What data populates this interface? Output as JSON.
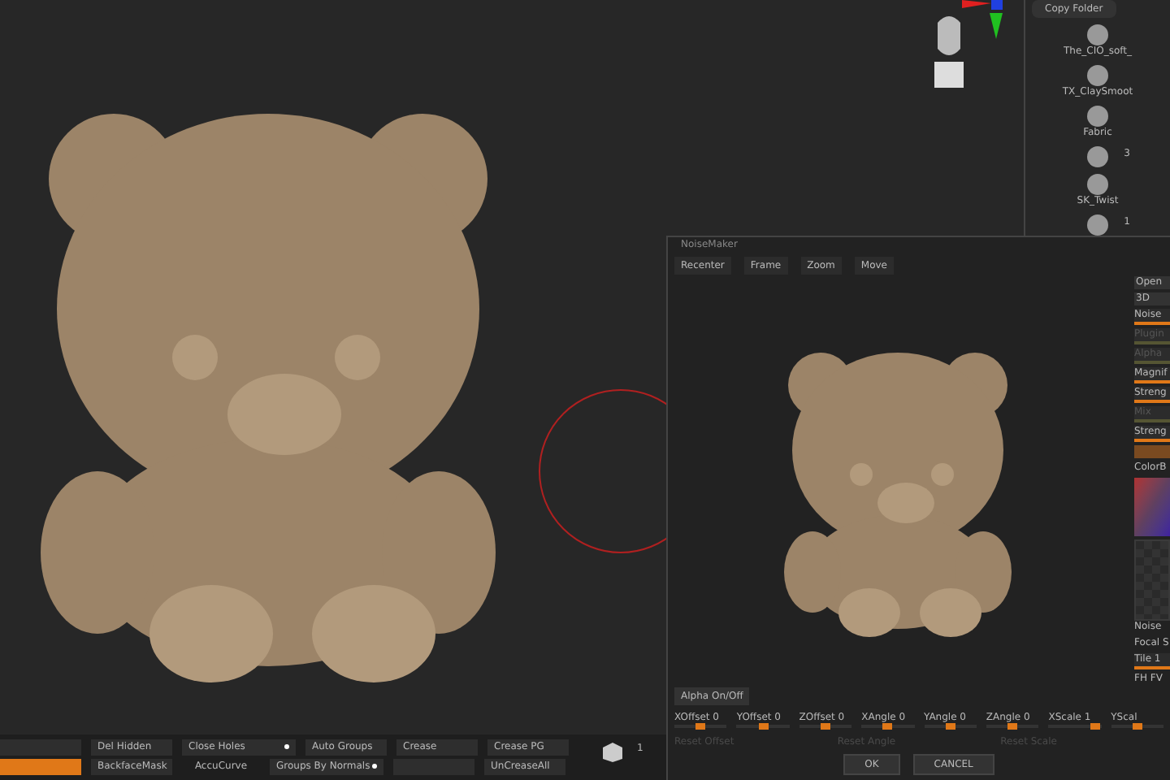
{
  "brushes": {
    "button": "Copy Folder",
    "items": [
      {
        "label": "The_CIO_soft_"
      },
      {
        "label": "TX_ClaySmoot"
      },
      {
        "label": "Fabric"
      },
      {
        "count": "3"
      },
      {
        "label": "SK_Twist"
      },
      {
        "count": "1"
      }
    ]
  },
  "toolbar": {
    "rows": [
      [
        {
          "kind": "button",
          "active": false
        },
        {
          "label": "Del Hidden",
          "kind": "button",
          "active": false
        },
        {
          "label": "Close Holes",
          "kind": "toggle",
          "active": false
        },
        {
          "label": "Auto Groups",
          "kind": "button",
          "active": false
        },
        {
          "label": "Crease",
          "kind": "button",
          "active": false
        },
        {
          "label": "Crease PG",
          "kind": "button",
          "active": false
        }
      ],
      [
        {
          "kind": "button",
          "active": true
        },
        {
          "label": "BackfaceMask",
          "kind": "button",
          "active": false
        },
        {
          "label": "AccuCurve",
          "kind": "plain",
          "active": false
        },
        {
          "label": "Groups By Normals",
          "kind": "toggle",
          "active": false
        },
        {
          "kind": "button",
          "active": false
        },
        {
          "label": "UnCreaseAll",
          "kind": "button",
          "active": false
        }
      ]
    ],
    "count": "1"
  },
  "noisemaker": {
    "title": "NoiseMaker",
    "tools": [
      "Recenter",
      "Frame",
      "Zoom",
      "Move"
    ],
    "alpha_button": "Alpha On/Off",
    "side": [
      {
        "label": "Open",
        "kind": "button",
        "dim": false
      },
      {
        "label": "3D",
        "kind": "button",
        "dim": false
      },
      {
        "label": "Noise",
        "kind": "slider",
        "dim": false
      },
      {
        "label": "Plugin",
        "kind": "slider",
        "dim": true
      },
      {
        "label": "Alpha",
        "kind": "slider",
        "dim": true
      },
      {
        "label": "Magnif",
        "kind": "slider",
        "dim": false
      },
      {
        "label": "Streng",
        "kind": "slider",
        "dim": false
      },
      {
        "label": "Mix",
        "kind": "slider",
        "dim": true
      },
      {
        "label": "Streng",
        "kind": "slider",
        "dim": false
      },
      {
        "kind": "swatch",
        "dim": false
      },
      {
        "label": "ColorB",
        "kind": "label",
        "dim": false
      },
      {
        "kind": "picker",
        "dim": false
      },
      {
        "label": "Noise",
        "kind": "checker",
        "dim": false
      },
      {
        "label": "Focal S",
        "kind": "label",
        "dim": false
      },
      {
        "label": "Tile 1",
        "kind": "slider",
        "dim": false
      },
      {
        "label": "FH FV",
        "kind": "label",
        "dim": false
      }
    ],
    "sliders": [
      {
        "label": "XOffset 0",
        "level": 0.5
      },
      {
        "label": "YOffset 0",
        "level": 0.5
      },
      {
        "label": "ZOffset 0",
        "level": 0.5
      },
      {
        "label": "XAngle 0",
        "level": 0.5
      },
      {
        "label": "YAngle 0",
        "level": 0.5
      },
      {
        "label": "ZAngle 0",
        "level": 0.5
      },
      {
        "label": "XScale 1",
        "level": 0.9
      },
      {
        "label": "YScal",
        "level": 0.5
      }
    ],
    "resets": [
      {
        "label": "Reset Offset",
        "disabled": true
      },
      {
        "label": "Reset Angle",
        "disabled": true
      },
      {
        "label": "Reset Scale",
        "disabled": true
      }
    ],
    "buttons": [
      "OK",
      "CANCEL"
    ]
  }
}
